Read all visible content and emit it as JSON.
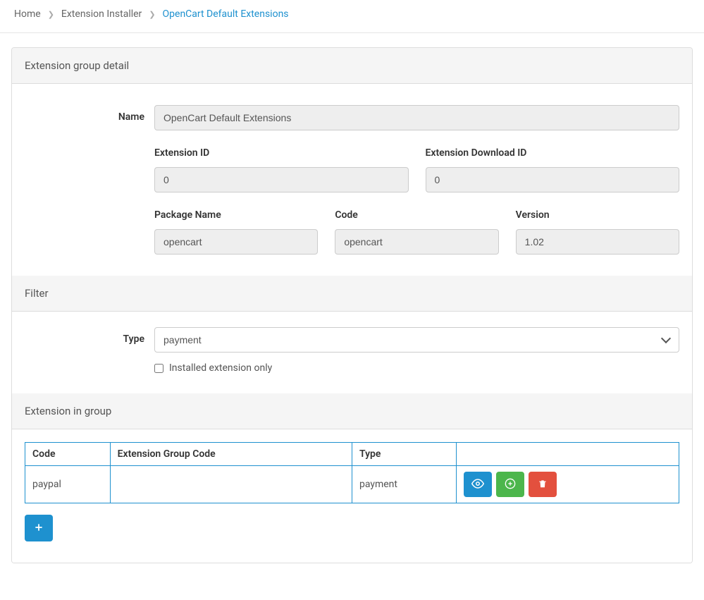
{
  "breadcrumb": {
    "home": "Home",
    "installer": "Extension Installer",
    "current": "OpenCart Default Extensions"
  },
  "panels": {
    "group_detail": "Extension group detail",
    "filter": "Filter",
    "in_group": "Extension in group"
  },
  "detail": {
    "name_label": "Name",
    "name_value": "OpenCart Default Extensions",
    "ext_id_label": "Extension ID",
    "ext_id_value": "0",
    "download_id_label": "Extension Download ID",
    "download_id_value": "0",
    "package_label": "Package Name",
    "package_value": "opencart",
    "code_label": "Code",
    "code_value": "opencart",
    "version_label": "Version",
    "version_value": "1.02"
  },
  "filter": {
    "type_label": "Type",
    "type_value": "payment",
    "installed_only_label": "Installed extension only"
  },
  "table": {
    "headers": {
      "code": "Code",
      "group_code": "Extension Group Code",
      "type": "Type"
    },
    "row": {
      "code": "paypal",
      "group_code": "",
      "type": "payment"
    }
  }
}
